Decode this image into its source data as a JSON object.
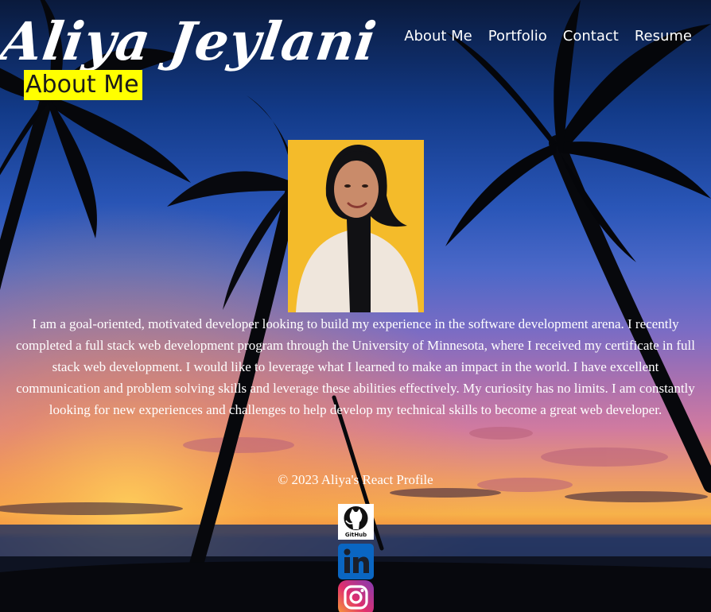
{
  "header": {
    "logo_text": "Aliya Jeylani",
    "nav": [
      {
        "label": "About Me"
      },
      {
        "label": "Portfolio"
      },
      {
        "label": "Contact"
      },
      {
        "label": "Resume"
      }
    ]
  },
  "main": {
    "section_title": "About Me",
    "portrait_icon": "profile-photo",
    "bio": "I am a goal-oriented, motivated developer looking to build my experience in the software development arena. I recently completed a full stack web development program through the University of Minnesota, where I received my certificate in full stack web development. I would like to leverage what I learned to make an impact in the world. I have excellent communication and problem solving skills and leverage these abilities effectively. My curiosity has no limits. I am constantly looking for new experiences and challenges to help develop my technical skills to become a great web developer."
  },
  "footer": {
    "copyright": "© 2023 Aliya's React Profile",
    "social": [
      {
        "icon": "github-icon",
        "label": "GitHub"
      },
      {
        "icon": "linkedin-icon"
      },
      {
        "icon": "instagram-icon"
      }
    ]
  },
  "colors": {
    "title_highlight": "#ffff00",
    "portrait_bg": "#f4bb2a",
    "linkedin_blue": "#0a66c2"
  }
}
